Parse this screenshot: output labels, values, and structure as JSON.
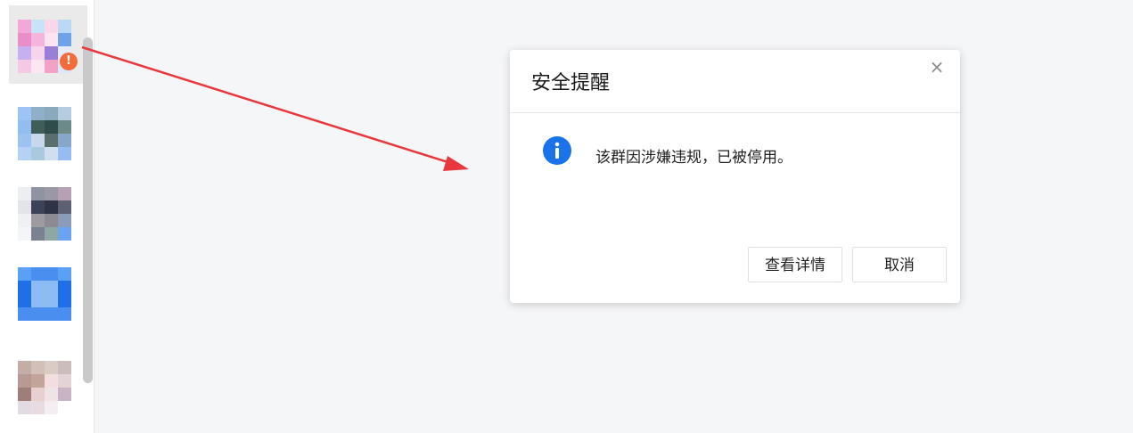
{
  "dialog": {
    "title": "安全提醒",
    "close_symbol": "×",
    "message": "该群因涉嫌违规，已被停用。",
    "buttons": {
      "details": "查看详情",
      "cancel": "取消"
    },
    "icon": "info-icon"
  },
  "sidebar": {
    "warning_badge": "!",
    "items": [
      {
        "name": "group-1",
        "status": "warning",
        "tiles": [
          "#f2a8d8",
          "#c8e2f8",
          "#f9d6e8",
          "#b9d9f6",
          "#e98ec7",
          "#f3b5dc",
          "#ffe3f1",
          "#6fa3e8",
          "#c5b1f1",
          "#f7d4ec",
          "#9a7fd9",
          "#e5ecf8",
          "#f5c8e3",
          "#fbe7f2",
          "#f3a2c7",
          "#dde6fa"
        ]
      },
      {
        "name": "group-2",
        "tiles": [
          "#9ec4f3",
          "#8fb0c9",
          "#8aa9bb",
          "#b6cde0",
          "#92bdf0",
          "#3f5e5a",
          "#2f4d4a",
          "#6c8a88",
          "#9cc2ef",
          "#c7d8ec",
          "#5a6f6c",
          "#86a7c9",
          "#b5d2f5",
          "#aac9de",
          "#d0deee",
          "#95bdf2"
        ]
      },
      {
        "name": "group-3",
        "tiles": [
          "#eceef2",
          "#8f94a3",
          "#9a98a4",
          "#b8a0b4",
          "#e2e4ea",
          "#3c4257",
          "#2e3345",
          "#5d6072",
          "#eef0f4",
          "#9e9aa2",
          "#8c8a92",
          "#8a9cb8",
          "#f4f5f8",
          "#7a8191",
          "#8fa7a2",
          "#6aa4f0"
        ]
      },
      {
        "name": "group-4",
        "tiles": [
          "#5aa1f5",
          "#4a8ff0",
          "#4a8ff0",
          "#5aa1f5",
          "#1f6fe8",
          "#8dbcf5",
          "#8dbcf5",
          "#1f6fe8",
          "#1f6fe8",
          "#8dbcf5",
          "#8dbcf5",
          "#1f6fe8",
          "#4a8ff0",
          "#4a8ff0",
          "#4a8ff0",
          "#4a8ff0"
        ]
      },
      {
        "name": "group-5",
        "tiles": [
          "#c3ada6",
          "#d2c0b8",
          "#d9ccc5",
          "#cabdba",
          "#b99a92",
          "#c2a49a",
          "#f1dedd",
          "#e3d3d7",
          "#9e7e78",
          "#e6d0d0",
          "#f0e3e6",
          "#c9b4c6",
          "#e3dbe3",
          "#e9dce0",
          "#f4eef2",
          "#ffffff"
        ]
      }
    ]
  }
}
